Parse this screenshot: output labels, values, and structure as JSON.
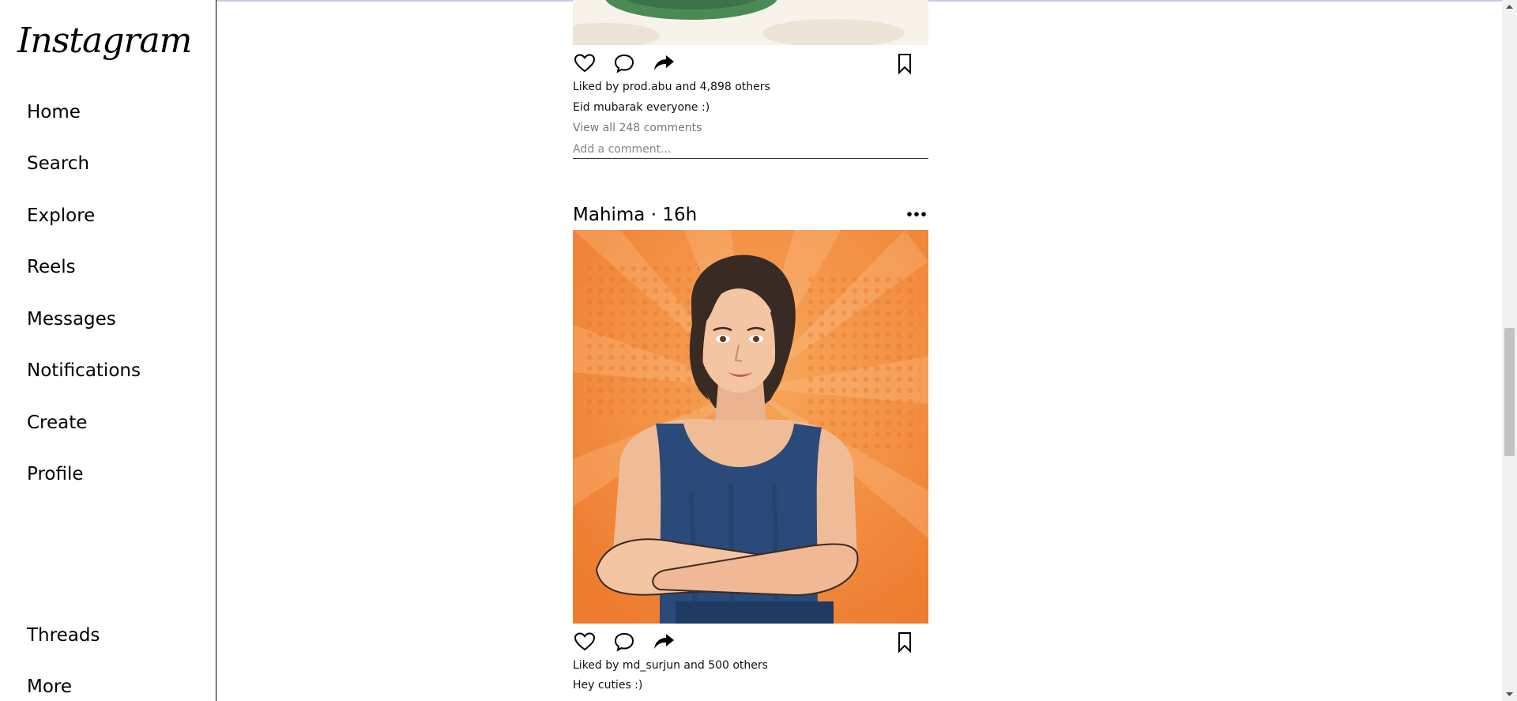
{
  "sidebar": {
    "logo": "Instagram",
    "items": [
      {
        "label": "Home"
      },
      {
        "label": "Search"
      },
      {
        "label": "Explore"
      },
      {
        "label": "Reels"
      },
      {
        "label": "Messages"
      },
      {
        "label": "Notifications"
      },
      {
        "label": "Create"
      },
      {
        "label": "Profile"
      }
    ],
    "bottom_items": [
      {
        "label": "Threads"
      },
      {
        "label": "More"
      }
    ]
  },
  "feed": {
    "posts": [
      {
        "likes_text": "Liked by prod.abu and 4,898 others",
        "caption": "Eid mubarak everyone :)",
        "view_comments": "View all 248 comments",
        "comment_placeholder": "Add a comment..."
      },
      {
        "author": "Mahima · 16h",
        "likes_text": "Liked by md_surjun and 500 others",
        "caption": "Hey cuties :)"
      }
    ]
  },
  "icons": {
    "like": "heart-icon",
    "comment": "comment-icon",
    "share": "share-icon",
    "save": "bookmark-icon",
    "more": "more-options-icon"
  },
  "colors": {
    "image_orange": "#f0883a",
    "image_orange_light": "#f7a65a",
    "dress_blue": "#2a4a7a",
    "hair": "#3a2a24",
    "skin": "#f3c5a3"
  }
}
